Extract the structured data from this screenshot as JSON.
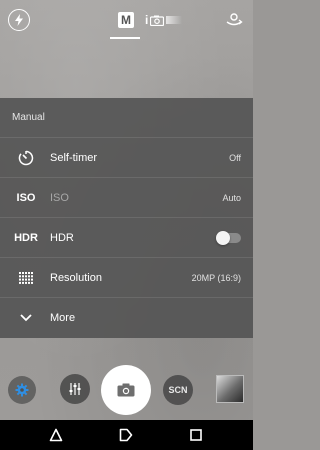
{
  "top_bar": {
    "modes": [
      {
        "label": "M",
        "active": true
      },
      {
        "label": "i",
        "active": false
      }
    ]
  },
  "panel": {
    "title": "Manual",
    "rows": [
      {
        "label": "Self-timer",
        "value": "Off",
        "icon": "self-timer-icon"
      },
      {
        "label": "ISO",
        "value": "Auto",
        "icon": "iso-icon",
        "icon_text": "ISO",
        "dimmed": true
      },
      {
        "label": "HDR",
        "icon": "hdr-icon",
        "icon_text": "HDR",
        "toggle_on": false
      },
      {
        "label": "Resolution",
        "value": "20MP (16:9)",
        "icon": "resolution-grid-icon"
      },
      {
        "label": "More",
        "icon": "chevron-down-icon"
      }
    ]
  },
  "controls": {
    "scn_label": "SCN"
  },
  "icons": [
    "flash-icon",
    "camera-switch-icon",
    "gear-icon",
    "sliders-icon",
    "camera-icon",
    "gallery-thumbnail",
    "back-icon",
    "home-icon",
    "recents-icon"
  ],
  "colors": {
    "panel_bg": "#555555",
    "settings_accent": "#2f8fe3"
  }
}
